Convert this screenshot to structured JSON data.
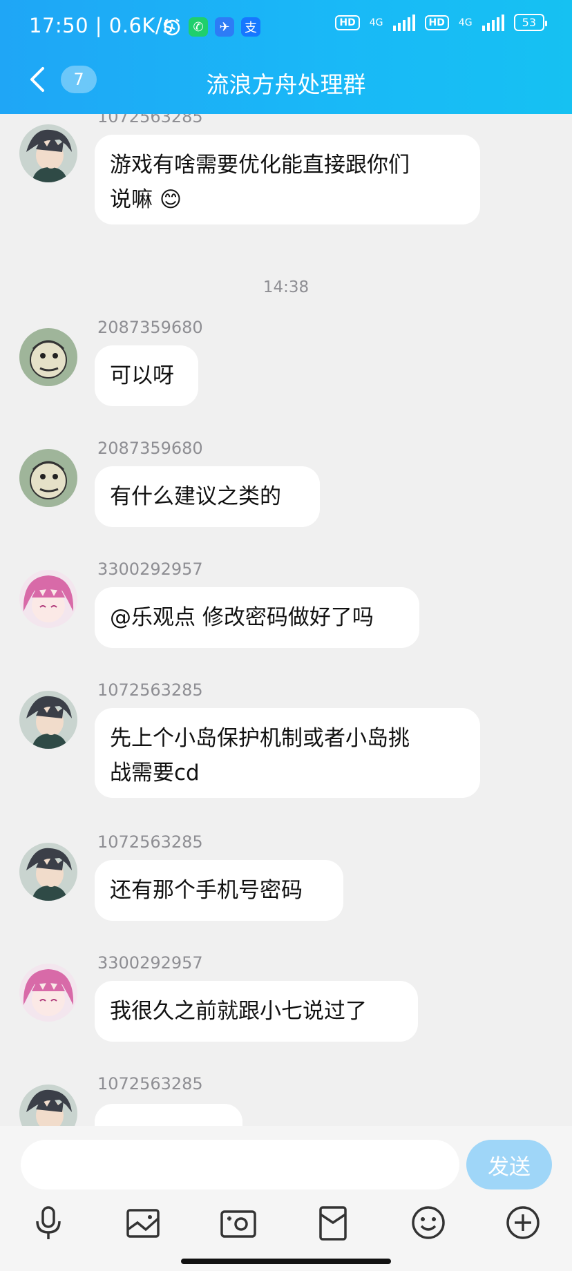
{
  "status_bar": {
    "time": "17:50",
    "speed": "0.6K/s",
    "hd1": "HD",
    "net1": "4G",
    "hd2": "HD",
    "net2": "4G",
    "battery": "53"
  },
  "header": {
    "unread_count": "7",
    "title": "流浪方舟处理群"
  },
  "messages": [
    {
      "sender": "1072563285",
      "text_lines": [
        "游戏有啥需要优化能直接跟你们",
        "说嘛"
      ],
      "emoji": "😊"
    },
    {
      "timestamp": "14:38"
    },
    {
      "sender": "2087359680",
      "text": "可以呀"
    },
    {
      "sender": "2087359680",
      "text": "有什么建议之类的"
    },
    {
      "sender": "3300292957",
      "text": "@乐观点 修改密码做好了吗"
    },
    {
      "sender": "1072563285",
      "text_lines": [
        "先上个小岛保护机制或者小岛挑",
        "战需要cd"
      ]
    },
    {
      "sender": "1072563285",
      "text": "还有那个手机号密码"
    },
    {
      "sender": "3300292957",
      "text": "我很久之前就跟小七说过了"
    },
    {
      "sender": "1072563285",
      "text": ""
    }
  ],
  "input": {
    "placeholder": "",
    "send_label": "发送"
  },
  "toolbar_icons": [
    "microphone-icon",
    "image-icon",
    "camera-icon",
    "red-packet-icon",
    "emoji-icon",
    "plus-icon"
  ],
  "colors": {
    "header_blue": "#1fa6f6",
    "send_button": "#9fd6f8",
    "chat_background": "#f0f0f0"
  }
}
